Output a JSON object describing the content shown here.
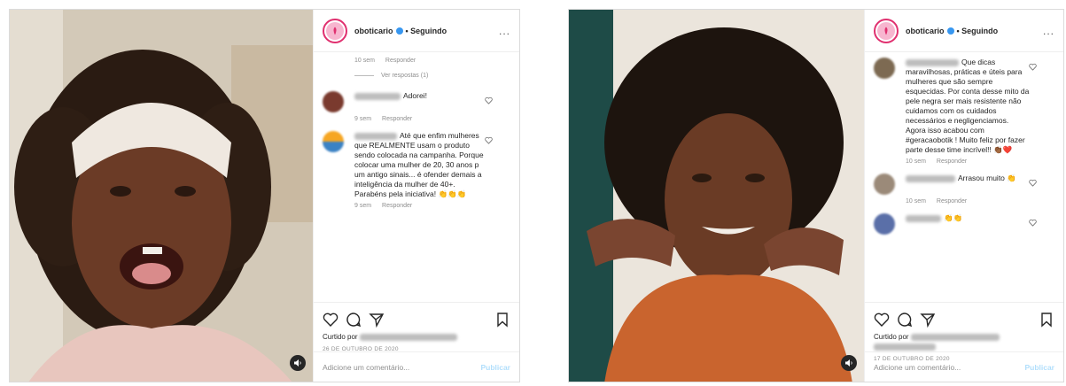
{
  "post1": {
    "username": "oboticario",
    "following": "• Seguindo",
    "more": "...",
    "top_meta": {
      "time": "10 sem",
      "reply": "Responder"
    },
    "replies_label": "Ver respostas (1)",
    "comments": [
      {
        "text": "Adorei!",
        "time": "9 sem",
        "reply": "Responder"
      },
      {
        "text": "Até que enfim mulheres que REALMENTE usam o produto sendo colocada na campanha. Porque colocar uma mulher de 20, 30 anos p um antigo sinais... é ofender demais a inteligência da mulher de 40+. Parabéns pela iniciativa! 👏👏👏",
        "time": "9 sem",
        "reply": "Responder"
      }
    ],
    "liked_by": "Curtido por",
    "date": "26 DE OUTUBRO DE 2020",
    "add_comment": "Adicione um comentário...",
    "publish": "Publicar"
  },
  "post2": {
    "username": "oboticario",
    "following": "• Seguindo",
    "more": "...",
    "comments": [
      {
        "text": "Que dicas maravilhosas, práticas e úteis para mulheres que são sempre esquecidas. Por conta desse mito da pele negra ser mais resistente não cuidamos com os cuidados necessários e negligenciamos. Agora isso acabou com #geracaobotik ! Muito feliz por fazer parte desse time incrível!! 👏🏾❤️",
        "time": "10 sem",
        "reply": "Responder"
      },
      {
        "text": "Arrasou muito 👏",
        "time": "10 sem",
        "reply": "Responder"
      },
      {
        "text": "👏👏",
        "time": "",
        "reply": ""
      }
    ],
    "liked_by": "Curtido por",
    "date": "17 DE OUTUBRO DE 2020",
    "add_comment": "Adicione um comentário...",
    "publish": "Publicar"
  },
  "icons": [
    "heart-icon",
    "comment-icon",
    "share-icon",
    "bookmark-icon",
    "sound-icon",
    "verified-icon"
  ],
  "colors": {
    "brand": "#e0306f",
    "verified": "#3897f0",
    "publish": "#b2dffc"
  }
}
